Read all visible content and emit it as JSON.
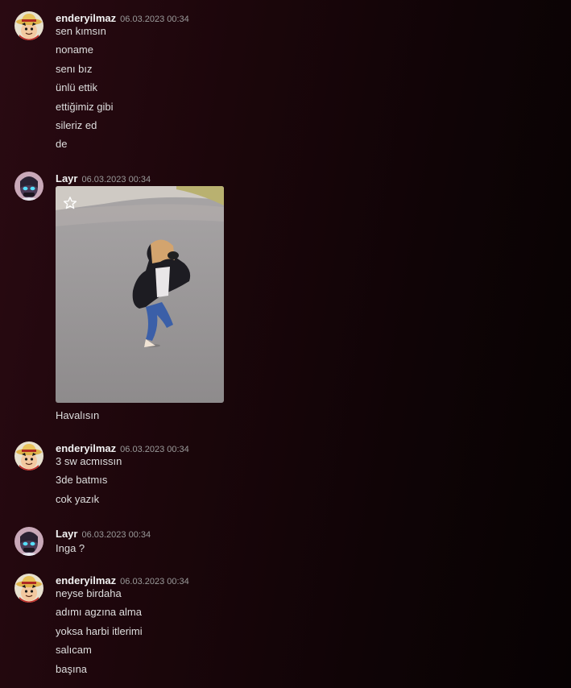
{
  "messages": [
    {
      "author": "enderyilmaz",
      "timestamp": "06.03.2023 00:34",
      "avatar_icon": "straw-hat-avatar-icon",
      "lines": [
        "sen kımsın",
        "noname",
        "senı bız",
        "ünlü ettik",
        "ettiğimiz gibi",
        "sileriz ed",
        "de"
      ]
    },
    {
      "author": "Layr",
      "timestamp": "06.03.2023 00:34",
      "avatar_icon": "masked-face-avatar-icon",
      "attachment_icon": "star-icon",
      "lines": [
        "Havalısın"
      ]
    },
    {
      "author": "enderyilmaz",
      "timestamp": "06.03.2023 00:34",
      "avatar_icon": "straw-hat-avatar-icon",
      "lines": [
        "3 sw acmıssın",
        "3de batmıs",
        "cok yazık"
      ]
    },
    {
      "author": "Layr",
      "timestamp": "06.03.2023 00:34",
      "avatar_icon": "masked-face-avatar-icon",
      "lines": [
        "Inga ?"
      ]
    },
    {
      "author": "enderyilmaz",
      "timestamp": "06.03.2023 00:34",
      "avatar_icon": "straw-hat-avatar-icon",
      "lines": [
        "neyse birdaha",
        "adımı agzına alma",
        "yoksa harbi itlerimi",
        "salıcam",
        "başına"
      ]
    }
  ]
}
